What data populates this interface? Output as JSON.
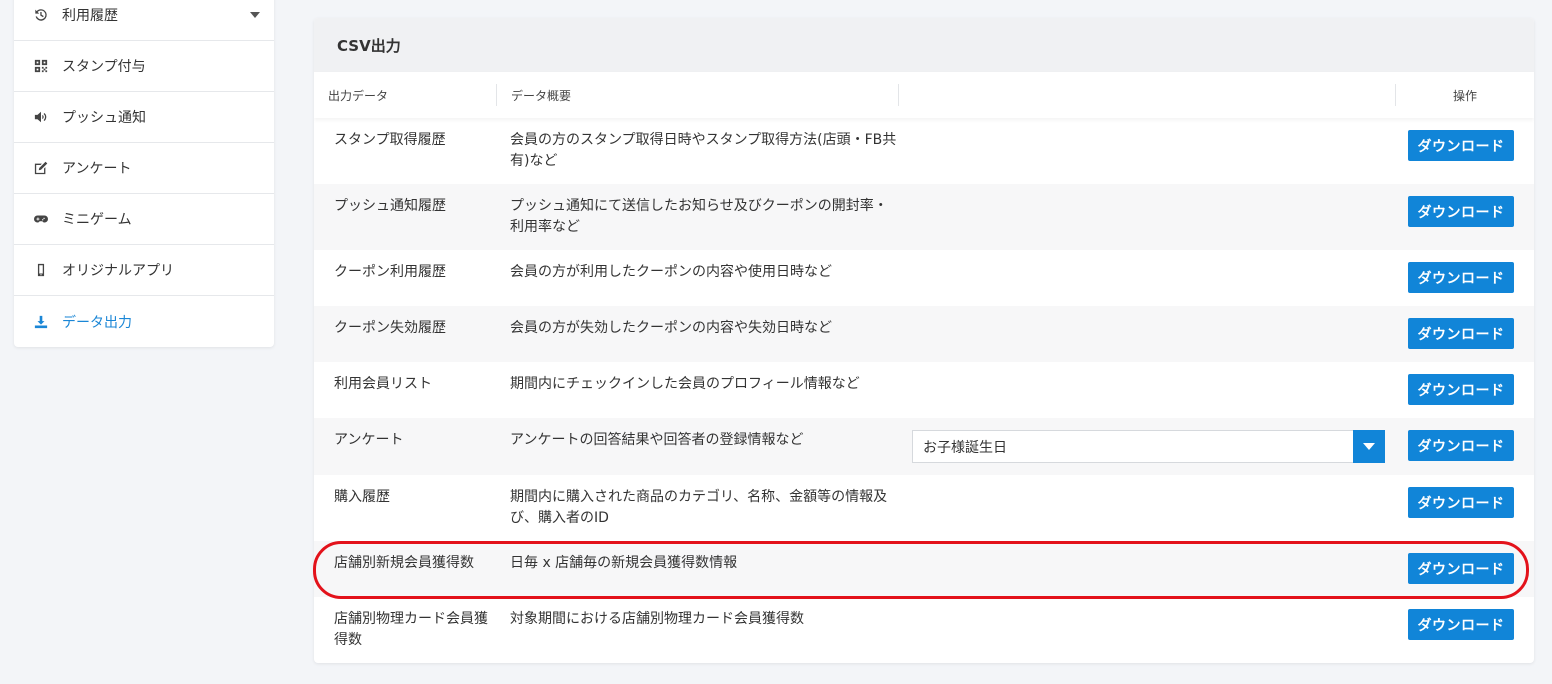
{
  "sidebar": {
    "items": [
      {
        "label": "利用履歴",
        "icon": "history-icon"
      },
      {
        "label": "スタンプ付与",
        "icon": "qrcode-icon"
      },
      {
        "label": "プッシュ通知",
        "icon": "volume-icon"
      },
      {
        "label": "アンケート",
        "icon": "edit-icon"
      },
      {
        "label": "ミニゲーム",
        "icon": "gamepad-icon"
      },
      {
        "label": "オリジナルアプリ",
        "icon": "mobile-icon"
      },
      {
        "label": "データ出力",
        "icon": "download-icon"
      }
    ]
  },
  "panel": {
    "title": "CSV出力",
    "columns": {
      "name": "出力データ",
      "description": "データ概要",
      "extra": "",
      "action": "操作"
    },
    "download_label": "ダウンロード",
    "rows": [
      {
        "name": "スタンプ取得履歴",
        "desc": "会員の方のスタンプ取得日時やスタンプ取得方法(店頭・FB共有)など"
      },
      {
        "name": "プッシュ通知履歴",
        "desc": "プッシュ通知にて送信したお知らせ及びクーポンの開封率・利用率など"
      },
      {
        "name": "クーポン利用履歴",
        "desc": "会員の方が利用したクーポンの内容や使用日時など"
      },
      {
        "name": "クーポン失効履歴",
        "desc": "会員の方が失効したクーポンの内容や失効日時など"
      },
      {
        "name": "利用会員リスト",
        "desc": "期間内にチェックインした会員のプロフィール情報など"
      },
      {
        "name": "アンケート",
        "desc": "アンケートの回答結果や回答者の登録情報など",
        "select_value": "お子様誕生日"
      },
      {
        "name": "購入履歴",
        "desc": "期間内に購入された商品のカテゴリ、名称、金額等の情報及び、購入者のID"
      },
      {
        "name": "店舗別新規会員獲得数",
        "desc": "日毎 x 店舗毎の新規会員獲得数情報"
      },
      {
        "name": "店舗別物理カード会員獲得数",
        "desc": "対象期間における店舗別物理カード会員獲得数"
      }
    ]
  },
  "colors": {
    "accent": "#1185d8",
    "active_nav": "#1a86d6",
    "highlight": "#e3121b"
  }
}
